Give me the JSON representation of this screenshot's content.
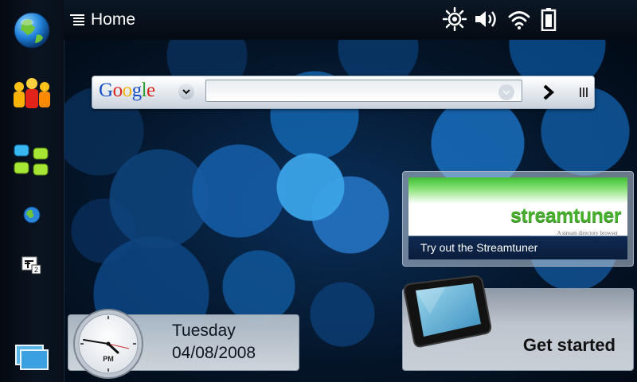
{
  "titlebar": {
    "menu_icon": "menu-list-icon",
    "title": "Home",
    "status_icons": [
      "brightness-icon",
      "volume-icon",
      "wifi-icon",
      "battery-icon"
    ]
  },
  "taskbar": {
    "items": [
      {
        "name": "web-browser-globe-icon"
      },
      {
        "name": "contacts-people-icon"
      },
      {
        "name": "applications-grid-icon"
      },
      {
        "name": "browser-small-globe-icon"
      },
      {
        "name": "task-switcher-icon",
        "badge": "2"
      },
      {
        "name": "open-windows-icon"
      }
    ]
  },
  "search": {
    "logo": [
      "G",
      "o",
      "o",
      "g",
      "l",
      "e"
    ],
    "logo_colors": [
      "#1a4fc4",
      "#d8241c",
      "#f0b40a",
      "#1a4fc4",
      "#2e9e2e",
      "#d8241c"
    ],
    "placeholder": "",
    "value": ""
  },
  "streamtuner": {
    "logo": "streamtuner",
    "tagline": "A stream directory browser",
    "caption": "Try out the Streamtuner"
  },
  "get_started": {
    "label": "Get started"
  },
  "clock": {
    "ampm": "PM",
    "day": "Tuesday",
    "date": "04/08/2008"
  }
}
